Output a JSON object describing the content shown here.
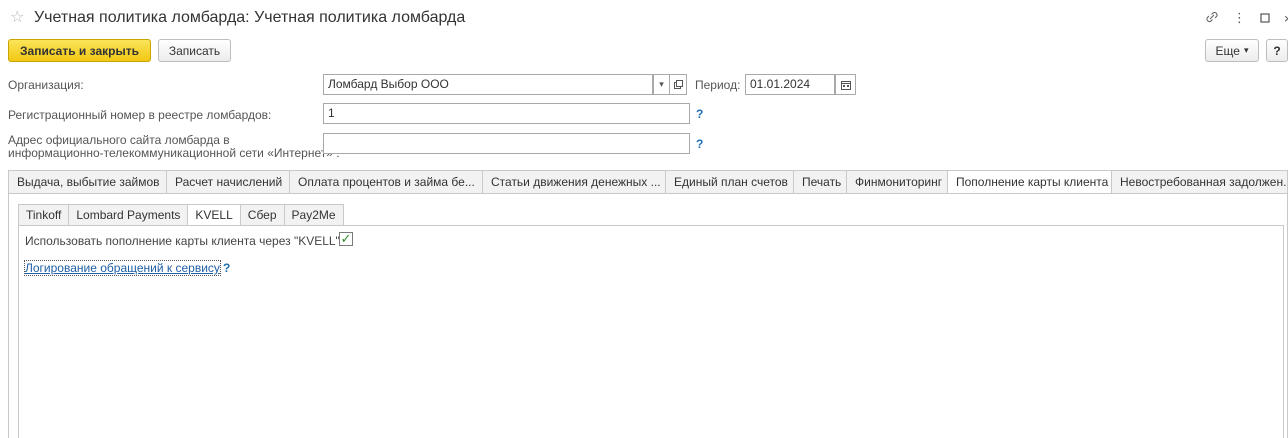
{
  "window": {
    "title": "Учетная политика ломбарда: Учетная политика ломбарда",
    "star_icon": "star-icon",
    "controls": [
      "link-icon",
      "more-icon",
      "maximize-icon",
      "close-icon"
    ]
  },
  "toolbar": {
    "save_close_label": "Записать и закрыть",
    "save_label": "Записать",
    "more_label": "Еще",
    "more_arrow": "▾",
    "help_label": "?"
  },
  "form": {
    "organization_label": "Организация:",
    "organization_value": "Ломбард Выбор ООО",
    "period_label": "Период:",
    "period_value": "01.01.2024",
    "reg_number_label": "Регистрационный номер в реестре ломбардов:",
    "reg_number_value": "1",
    "site_label_line1": "Адрес официального сайта ломбарда в",
    "site_label_line2": "информационно-телекоммуникационной сети «Интернет» :",
    "site_value": "",
    "help_mark": "?"
  },
  "tabs": [
    {
      "label": "Выдача, выбытие займов",
      "active": false
    },
    {
      "label": "Расчет начислений",
      "active": false
    },
    {
      "label": "Оплата процентов и займа бе...",
      "active": false
    },
    {
      "label": "Статьи движения денежных ...",
      "active": false
    },
    {
      "label": "Единый план счетов",
      "active": false
    },
    {
      "label": "Печать",
      "active": false
    },
    {
      "label": "Финмониторинг",
      "active": false
    },
    {
      "label": "Пополнение карты клиента",
      "active": true
    },
    {
      "label": "Невостребованная задолжен...",
      "active": false
    }
  ],
  "subtabs": [
    {
      "label": "Tinkoff",
      "active": false
    },
    {
      "label": "Lombard Payments",
      "active": false
    },
    {
      "label": "KVELL",
      "active": true
    },
    {
      "label": "Сбер",
      "active": false
    },
    {
      "label": "Pay2Me",
      "active": false
    }
  ],
  "kvell": {
    "use_label": "Использовать пополнение карты клиента через \"KVELL\":",
    "use_checked": true,
    "log_link": "Логирование обращений к сервису",
    "help_mark": "?"
  },
  "colors": {
    "primary_button": "#f2c812",
    "link": "#1f5fa8",
    "check": "#2e8b2e"
  }
}
